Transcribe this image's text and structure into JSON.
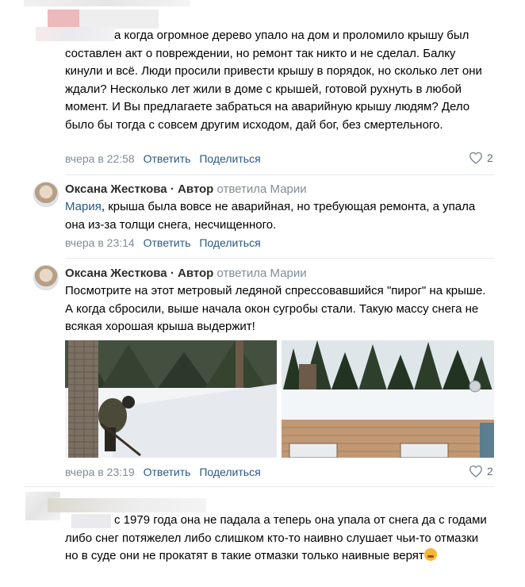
{
  "comment1": {
    "text": "а когда огромное дерево упало на дом и проломило крышу был составлен акт о повреждении, но ремонт так никто и не сделал. Балку кинули и всё. Люди просили привести крышу в порядок, но сколько лет они ждали? Несколько лет жили в доме с крышей, готовой рухнуть в любой момент. И Вы предлагаете забраться на аварийную крышу людям? Дело было бы тогда с совсем другим исходом, дай бог, без смертельного.",
    "time": "вчера в 22:58",
    "reply_label": "Ответить",
    "share_label": "Поделиться",
    "likes": "2"
  },
  "comment2": {
    "author": "Оксана Жесткова",
    "author_tag": "· Автор",
    "replied_to": "ответила Марии",
    "mention": "Мария",
    "text": ", крыша была вовсе не аварийная, но требующая ремонта, а упала она из-за толщи снега, несчищенного.",
    "time": "вчера в 23:14",
    "reply_label": "Ответить",
    "share_label": "Поделиться"
  },
  "comment3": {
    "author": "Оксана Жесткова",
    "author_tag": "· Автор",
    "replied_to": "ответила Марии",
    "text": "Посмотрите на этот метровый ледяной спрессовавшийся \"пирог\" на крыше. А когда сбросили, выше начала окон сугробы стали. Такую массу снега не всякая хорошая крыша выдержит!",
    "time": "вчера в 23:19",
    "reply_label": "Ответить",
    "share_label": "Поделиться",
    "likes": "2"
  },
  "comment4": {
    "text": "с 1979 года она не падала а теперь она упала от снега да с годами либо снег потяжелел либо слишком кто-то наивно слушает чьи-то отмазки но в суде они не прокатят в такие отмазки только наивные верят"
  },
  "colors": {
    "link": "#2a5885",
    "meta": "#818c99",
    "divider": "#e7e8ec"
  }
}
